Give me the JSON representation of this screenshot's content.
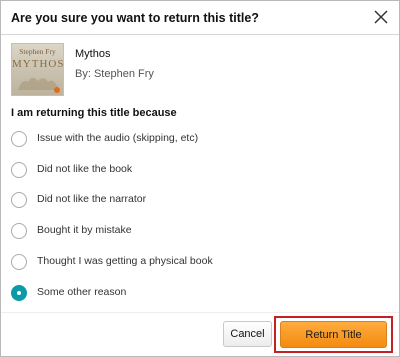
{
  "dialog": {
    "title": "Are you sure you want to return this title?",
    "close_icon": "close-icon"
  },
  "book": {
    "cover_author": "Stephen Fry",
    "cover_title": "MYTHOS",
    "title": "Mythos",
    "author_line": "By: Stephen Fry"
  },
  "reasons": {
    "heading": "I am returning this title because",
    "options": [
      {
        "label": "Issue with the audio (skipping, etc)",
        "selected": false
      },
      {
        "label": "Did not like the book",
        "selected": false
      },
      {
        "label": "Did not like the narrator",
        "selected": false
      },
      {
        "label": "Bought it by mistake",
        "selected": false
      },
      {
        "label": "Thought I was getting a physical book",
        "selected": false
      },
      {
        "label": "Some other reason",
        "selected": true
      }
    ]
  },
  "footer": {
    "cancel_label": "Cancel",
    "return_label": "Return Title"
  },
  "colors": {
    "accent_teal": "#0a9aa8",
    "return_orange": "#f38b10",
    "highlight_red": "#c42125"
  }
}
